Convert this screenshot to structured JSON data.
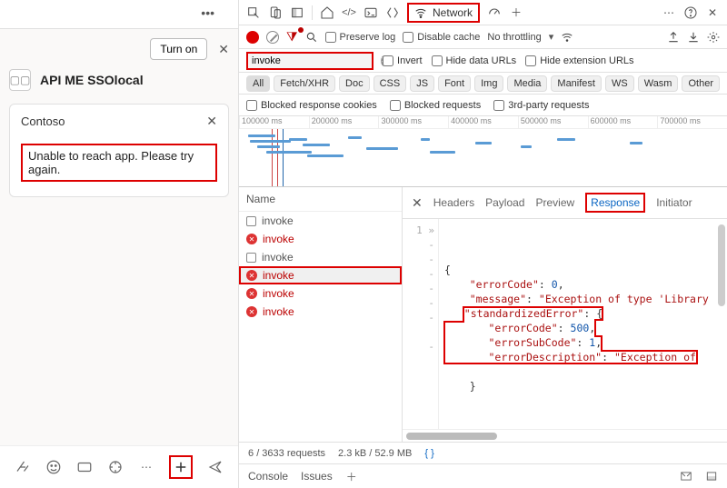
{
  "left": {
    "turn_on": "Turn on",
    "app_title": "API ME SSOlocal",
    "card_title": "Contoso",
    "error_message": "Unable to reach app. Please try again."
  },
  "toolbar": {
    "network_label": "Network"
  },
  "row2": {
    "preserve_log": "Preserve log",
    "disable_cache": "Disable cache",
    "throttling": "No throttling"
  },
  "filter": {
    "value": "invoke",
    "invert": "Invert",
    "hide_data_urls": "Hide data URLs",
    "hide_ext_urls": "Hide extension URLs"
  },
  "types": [
    "All",
    "Fetch/XHR",
    "Doc",
    "CSS",
    "JS",
    "Font",
    "Img",
    "Media",
    "Manifest",
    "WS",
    "Wasm",
    "Other"
  ],
  "row5": {
    "blocked_cookies": "Blocked response cookies",
    "blocked_requests": "Blocked requests",
    "third_party": "3rd-party requests"
  },
  "ruler": [
    "100000 ms",
    "200000 ms",
    "300000 ms",
    "400000 ms",
    "500000 ms",
    "600000 ms",
    "700000 ms"
  ],
  "req": {
    "name_header": "Name",
    "rows": [
      {
        "status": "pending",
        "name": "invoke"
      },
      {
        "status": "error",
        "name": "invoke"
      },
      {
        "status": "pending",
        "name": "invoke"
      },
      {
        "status": "error",
        "name": "invoke",
        "selected": true
      },
      {
        "status": "error",
        "name": "invoke"
      },
      {
        "status": "error",
        "name": "invoke"
      }
    ]
  },
  "detail_tabs": {
    "headers": "Headers",
    "payload": "Payload",
    "preview": "Preview",
    "response": "Response",
    "initiator": "Initiator"
  },
  "response_json": {
    "line1": "{",
    "line2a": "\"errorCode\"",
    "line2b": ": ",
    "line2c": "0",
    "line2d": ",",
    "line3a": "\"message\"",
    "line3b": ": ",
    "line3c": "\"Exception of type 'Library",
    "line4a": "\"standardizedError\"",
    "line4b": ": {",
    "line5a": "\"errorCode\"",
    "line5b": ": ",
    "line5c": "500",
    "line5d": ",",
    "line6a": "\"errorSubCode\"",
    "line6b": ": ",
    "line6c": "1",
    "line6d": ",",
    "line7a": "\"errorDescription\"",
    "line7b": ": ",
    "line7c": "\"Exception of",
    "line8": "}"
  },
  "status": {
    "requests": "6 / 3633 requests",
    "size": "2.3 kB / 52.9 MB"
  },
  "drawer": {
    "console": "Console",
    "issues": "Issues"
  }
}
